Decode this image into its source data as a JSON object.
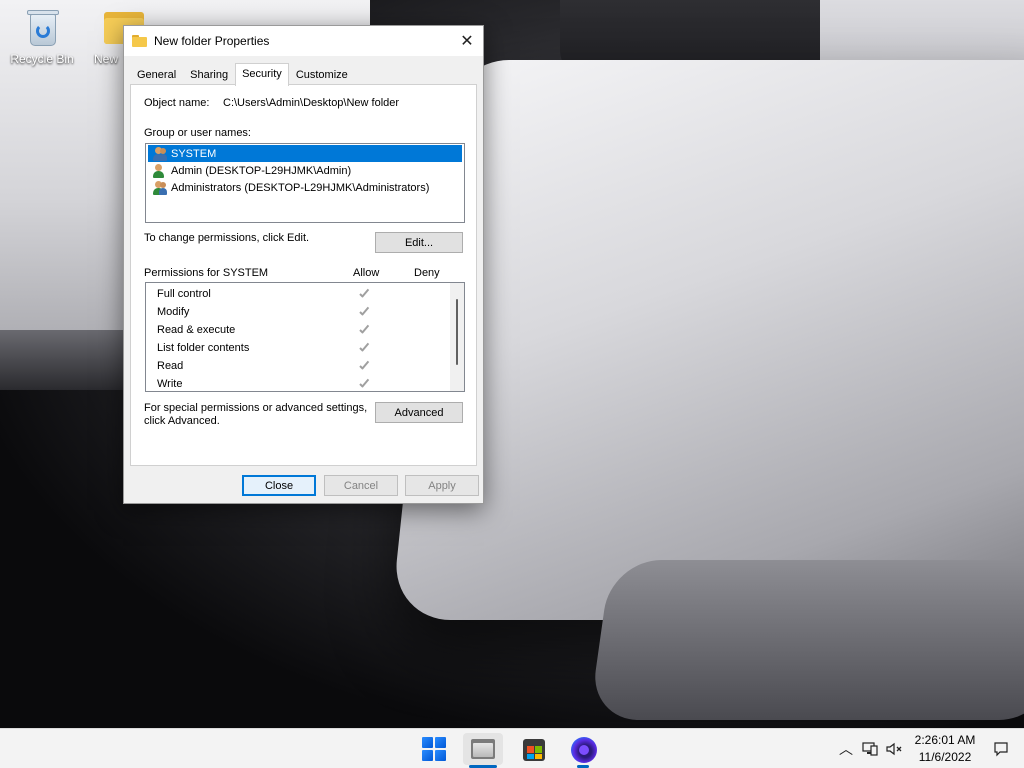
{
  "desktop": {
    "icons": [
      {
        "label": "Recycle Bin"
      },
      {
        "label": "New"
      }
    ]
  },
  "dialog": {
    "title": "New folder Properties",
    "tabs": [
      {
        "label": "General"
      },
      {
        "label": "Sharing"
      },
      {
        "label": "Security"
      },
      {
        "label": "Customize"
      }
    ],
    "object_name_label": "Object name:",
    "object_name_value": "C:\\Users\\Admin\\Desktop\\New folder",
    "group_label": "Group or user names:",
    "users": [
      {
        "name": "SYSTEM"
      },
      {
        "name": "Admin (DESKTOP-L29HJMK\\Admin)"
      },
      {
        "name": "Administrators (DESKTOP-L29HJMK\\Administrators)"
      }
    ],
    "change_permissions_text": "To change permissions, click Edit.",
    "edit_button": "Edit...",
    "permissions_for_label": "Permissions for SYSTEM",
    "allow_header": "Allow",
    "deny_header": "Deny",
    "permissions": [
      {
        "name": "Full control"
      },
      {
        "name": "Modify"
      },
      {
        "name": "Read & execute"
      },
      {
        "name": "List folder contents"
      },
      {
        "name": "Read"
      },
      {
        "name": "Write"
      }
    ],
    "advanced_text_line1": "For special permissions or advanced settings,",
    "advanced_text_line2": "click Advanced.",
    "advanced_button": "Advanced",
    "close_button": "Close",
    "cancel_button": "Cancel",
    "apply_button": "Apply"
  },
  "taskbar": {
    "apps": [
      {
        "icon": "windows-start-icon"
      },
      {
        "icon": "file-explorer-icon"
      },
      {
        "icon": "microsoft-store-icon"
      },
      {
        "icon": "firefox-icon"
      }
    ],
    "time": "2:26:01 AM",
    "date": "11/6/2022"
  },
  "colors": {
    "selection": "#0078d7",
    "taskbar_accent": "#0067c0"
  }
}
